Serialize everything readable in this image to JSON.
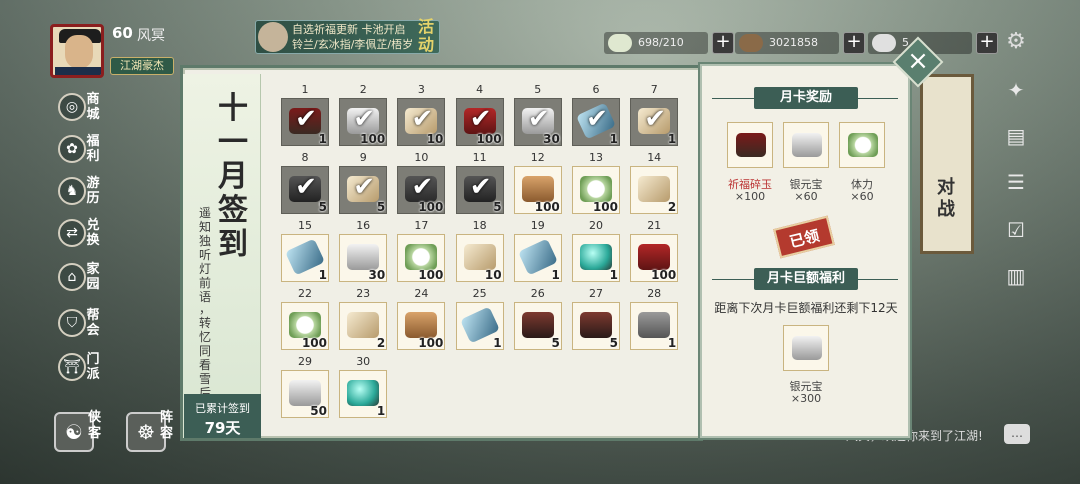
{
  "player": {
    "level": "60",
    "name": "风冥",
    "title": "江湖豪杰"
  },
  "event": {
    "line1": "自选祈福更新 卡池开启",
    "line2": "铃兰/玄冰指/李佩芷/梧岁",
    "tag": "活动"
  },
  "resources": [
    {
      "name": "stamina",
      "value": "698/210",
      "color": "#dfe8d0"
    },
    {
      "name": "copper",
      "value": "3021858",
      "color": "#8a6a48"
    },
    {
      "name": "silver",
      "value": "5",
      "color": "#e0e0e0"
    }
  ],
  "left_nav": [
    {
      "label": "商城",
      "icon": "shop-icon"
    },
    {
      "label": "福利",
      "icon": "gift-icon"
    },
    {
      "label": "游历",
      "icon": "horse-icon"
    },
    {
      "label": "兑换",
      "icon": "exchange-icon"
    },
    {
      "label": "家园",
      "icon": "home-icon"
    },
    {
      "label": "帮会",
      "icon": "guild-icon"
    },
    {
      "label": "门派",
      "icon": "sect-icon"
    }
  ],
  "bottom_nav": [
    {
      "label": "侠客"
    },
    {
      "label": "阵容"
    }
  ],
  "right_nav": [
    {
      "icon": "map-icon"
    },
    {
      "icon": "bag-icon"
    },
    {
      "icon": "scroll-icon"
    },
    {
      "icon": "task-icon"
    },
    {
      "icon": "book-icon"
    }
  ],
  "battle": {
    "label": "对战"
  },
  "chat": {
    "message": "风冥，欢迎你来到了江湖!"
  },
  "signin": {
    "month_title": "十一月签到",
    "poem_col1": "遥知独听灯前语",
    "poem_col2": "，转忆同看雪后山",
    "total_label": "已累计签到",
    "total_days": "79天",
    "days": [
      {
        "day": "1",
        "item": "chest",
        "count": "1",
        "done": true
      },
      {
        "day": "2",
        "item": "silver",
        "count": "100",
        "done": true
      },
      {
        "day": "3",
        "item": "book",
        "count": "10",
        "done": true
      },
      {
        "day": "4",
        "item": "flag",
        "count": "100",
        "done": true
      },
      {
        "day": "5",
        "item": "silver",
        "count": "30",
        "done": true
      },
      {
        "day": "6",
        "item": "jade",
        "count": "1",
        "done": true
      },
      {
        "day": "7",
        "item": "book",
        "count": "1",
        "done": true
      },
      {
        "day": "8",
        "item": "case",
        "count": "5",
        "done": true
      },
      {
        "day": "9",
        "item": "book",
        "count": "5",
        "done": true
      },
      {
        "day": "10",
        "item": "glove",
        "count": "100",
        "done": true
      },
      {
        "day": "11",
        "item": "case",
        "count": "5",
        "done": true
      },
      {
        "day": "12",
        "item": "token",
        "count": "100",
        "done": false
      },
      {
        "day": "13",
        "item": "bun",
        "count": "100",
        "done": false
      },
      {
        "day": "14",
        "item": "book",
        "count": "2",
        "done": false
      },
      {
        "day": "15",
        "item": "jade",
        "count": "1",
        "done": false
      },
      {
        "day": "16",
        "item": "silver",
        "count": "30",
        "done": false
      },
      {
        "day": "17",
        "item": "bun",
        "count": "100",
        "done": false
      },
      {
        "day": "18",
        "item": "book",
        "count": "10",
        "done": false
      },
      {
        "day": "19",
        "item": "jade",
        "count": "1",
        "done": false
      },
      {
        "day": "20",
        "item": "orb",
        "count": "1",
        "done": false
      },
      {
        "day": "21",
        "item": "flag",
        "count": "100",
        "done": false
      },
      {
        "day": "22",
        "item": "bun",
        "count": "100",
        "done": false
      },
      {
        "day": "23",
        "item": "book",
        "count": "2",
        "done": false
      },
      {
        "day": "24",
        "item": "token",
        "count": "100",
        "done": false
      },
      {
        "day": "25",
        "item": "jade",
        "count": "1",
        "done": false
      },
      {
        "day": "26",
        "item": "box",
        "count": "5",
        "done": false
      },
      {
        "day": "27",
        "item": "box",
        "count": "5",
        "done": false
      },
      {
        "day": "28",
        "item": "hammer",
        "count": "1",
        "done": false
      },
      {
        "day": "29",
        "item": "silver",
        "count": "50",
        "done": false
      },
      {
        "day": "30",
        "item": "orb",
        "count": "1",
        "done": false
      }
    ]
  },
  "monthly_card": {
    "header": "月卡奖励",
    "rewards": [
      {
        "item": "chest",
        "name": "祈福碎玉",
        "count": "×100",
        "highlight": true
      },
      {
        "item": "silver",
        "name": "银元宝",
        "count": "×60",
        "highlight": false
      },
      {
        "item": "bun",
        "name": "体力",
        "count": "×60",
        "highlight": false
      }
    ],
    "claimed": "已领",
    "big_header": "月卡巨额福利",
    "remain": "距离下次月卡巨额福利还剩下12天",
    "big_reward": {
      "item": "silver",
      "name": "银元宝",
      "count": "×300"
    }
  }
}
